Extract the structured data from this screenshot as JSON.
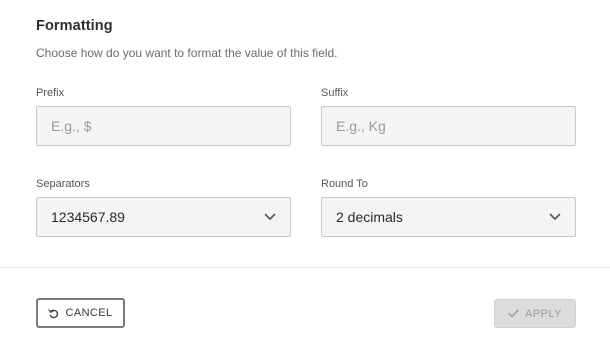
{
  "section": {
    "title": "Formatting",
    "description": "Choose how do you want to format the value of this field."
  },
  "prefix": {
    "label": "Prefix",
    "placeholder": "E.g., $",
    "value": ""
  },
  "suffix": {
    "label": "Suffix",
    "placeholder": "E.g., Kg",
    "value": ""
  },
  "separators": {
    "label": "Separators",
    "selected": "1234567.89"
  },
  "round_to": {
    "label": "Round To",
    "selected": "2 decimals"
  },
  "actions": {
    "cancel_label": "CANCEL",
    "cancel_icon": "undo-icon",
    "apply_label": "APPLY",
    "apply_icon": "check-icon",
    "apply_disabled": true
  }
}
